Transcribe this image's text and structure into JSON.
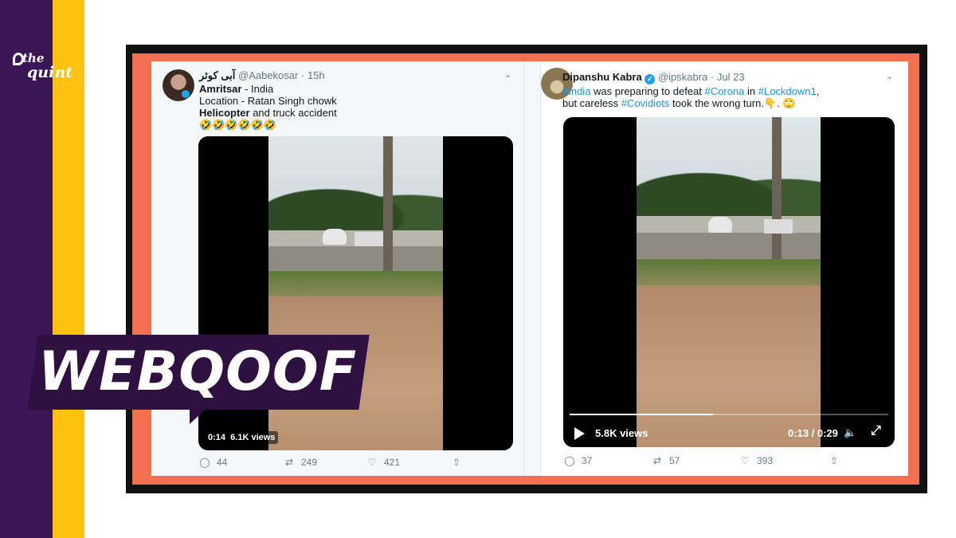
{
  "brand": {
    "line1": "the",
    "line2": "quint"
  },
  "badge": {
    "label": "WEBQOOF"
  },
  "colors": {
    "purple": "#3a1657",
    "yellow": "#ffc20e",
    "orange": "#f26f4f",
    "link_blue": "#1b95e0"
  },
  "tweet_left": {
    "name": "آبی کوثر",
    "handle": "@Aabekosar",
    "separator": "·",
    "time": "15h",
    "lines": {
      "l1_bold": "Amritsar",
      "l1_rest": " - India",
      "l2": "Location - Ratan Singh chowk",
      "l3_bold": "Helicopter",
      "l3_rest": " and truck accident",
      "l4": "🤣🤣🤣🤣🤣🤣"
    },
    "video": {
      "time": "0:14",
      "views": "6.1K views"
    },
    "actions": {
      "replies": "44",
      "retweets": "249",
      "likes": "421"
    },
    "icons": [
      "reply-icon",
      "retweet-icon",
      "like-icon",
      "share-icon",
      "chevron-down-icon",
      "verified-icon"
    ]
  },
  "tweet_right": {
    "name": "Dipanshu Kabra",
    "verified": "✓",
    "handle": "@ipskabra",
    "separator": "·",
    "time": "Jul 23",
    "lines": {
      "t1": "#India",
      "t2": " was preparing to defeat ",
      "t3": "#Corona",
      "t4": " in ",
      "t5": "#Lockdown1",
      "t6": ",",
      "u1": "but careless ",
      "u2": "#Covidiots",
      "u3": " took the wrong turn.",
      "u4": "👇. 🙄"
    },
    "video": {
      "views": "5.8K views",
      "elapsed": "0:13",
      "duration": "0:29",
      "progress_fraction": 0.45
    },
    "actions": {
      "replies": "37",
      "retweets": "57",
      "likes": "393"
    },
    "icons": [
      "play-icon",
      "volume-icon",
      "fullscreen-icon",
      "reply-icon",
      "retweet-icon",
      "like-icon",
      "share-icon",
      "chevron-down-icon"
    ]
  },
  "glyphs": {
    "reply": "◯",
    "retweet": "⇄",
    "like": "♡",
    "share": "⇧",
    "chevron": "⌄",
    "volume": "🔈",
    "fullscreen": "⤢"
  }
}
